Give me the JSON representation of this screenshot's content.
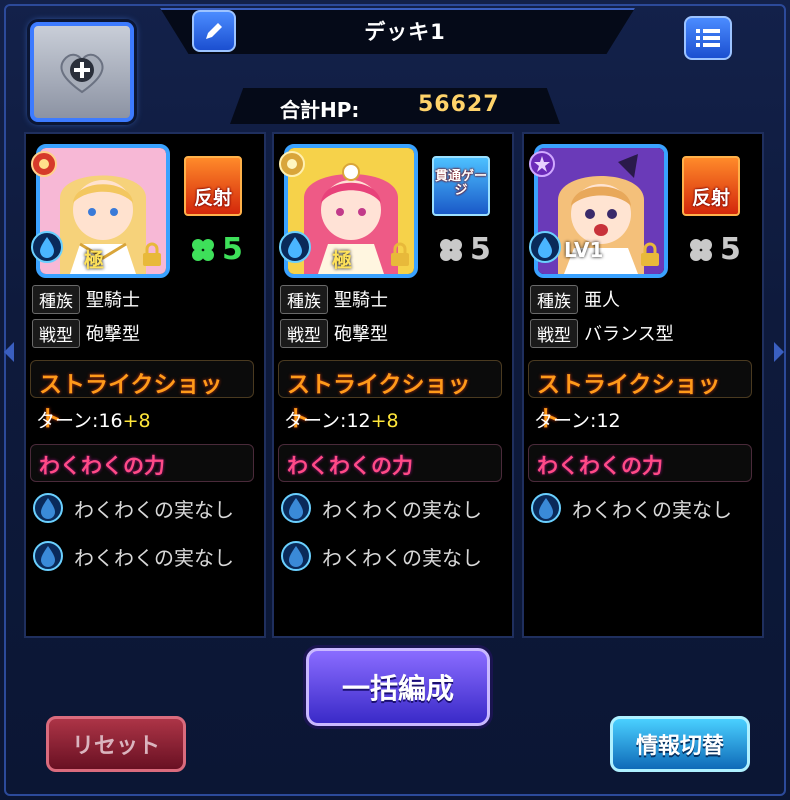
{
  "header": {
    "deck_title": "デッキ1",
    "hp_label": "合計HP:",
    "hp_value": "56627"
  },
  "icons": {
    "add": "plus-heart-icon",
    "edit": "pencil-icon",
    "menu": "list-icon",
    "lock": "lock-icon",
    "element": "water-element-icon",
    "clover": "clover-icon",
    "fruit": "fruit-icon"
  },
  "colors": {
    "accent_blue": "#3aa2ff",
    "strike_orange": "#ff9a1a",
    "waku_pink": "#ff4a86",
    "luck_green": "#3ee05a",
    "hp_gold": "#ffd36a"
  },
  "monsters": [
    {
      "grade": "極",
      "ability": "反射",
      "luck": "5",
      "tribe_label": "種族",
      "tribe": "聖騎士",
      "type_label": "戦型",
      "type": "砲撃型",
      "strike_label": "ストライクショット",
      "turn_prefix": "ターン:",
      "turns": "16",
      "turn_bonus": "+8",
      "waku_label": "わくわくの力",
      "fruits": [
        "わくわくの実なし",
        "わくわくの実なし"
      ]
    },
    {
      "grade": "極",
      "ability": "貫通ゲージ",
      "luck": "5",
      "tribe_label": "種族",
      "tribe": "聖騎士",
      "type_label": "戦型",
      "type": "砲撃型",
      "strike_label": "ストライクショット",
      "turn_prefix": "ターン:",
      "turns": "12",
      "turn_bonus": "+8",
      "waku_label": "わくわくの力",
      "fruits": [
        "わくわくの実なし",
        "わくわくの実なし"
      ]
    },
    {
      "grade": "LV1",
      "ability": "反射",
      "luck": "5",
      "tribe_label": "種族",
      "tribe": "亜人",
      "type_label": "戦型",
      "type": "バランス型",
      "strike_label": "ストライクショット",
      "turn_prefix": "ターン:",
      "turns": "12",
      "turn_bonus": "",
      "waku_label": "わくわくの力",
      "fruits": [
        "わくわくの実なし"
      ]
    }
  ],
  "buttons": {
    "bulk": "一括編成",
    "reset": "リセット",
    "info": "情報切替"
  }
}
